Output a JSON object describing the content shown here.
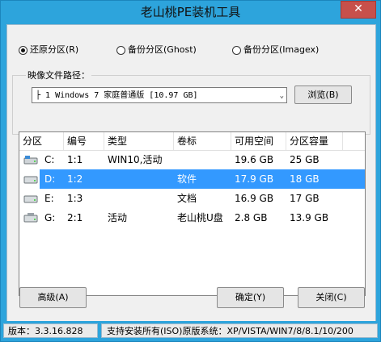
{
  "window": {
    "title": "老山桃PE装机工具",
    "close_symbol": "✕"
  },
  "options": {
    "restore": "还原分区(R)",
    "backup_ghost": "备份分区(Ghost)",
    "backup_imagex": "备份分区(Imagex)",
    "selected": "restore"
  },
  "image_path": {
    "label": "映像文件路径：",
    "value": "├ 1 Windows 7 家庭普通版 [10.97 GB]",
    "browse_label": "浏览(B)"
  },
  "table": {
    "headers": [
      "分区",
      "编号",
      "类型",
      "卷标",
      "可用空间",
      "分区容量"
    ],
    "rows": [
      {
        "drive": "C:",
        "num": "1:1",
        "type": "WIN10,活动",
        "label": "",
        "free": "19.6 GB",
        "size": "25 GB",
        "selected": false
      },
      {
        "drive": "D:",
        "num": "1:2",
        "type": "",
        "label": "软件",
        "free": "17.9 GB",
        "size": "18 GB",
        "selected": true
      },
      {
        "drive": "E:",
        "num": "1:3",
        "type": "",
        "label": "文档",
        "free": "16.9 GB",
        "size": "17 GB",
        "selected": false
      },
      {
        "drive": "G:",
        "num": "2:1",
        "type": "活动",
        "label": "老山桃U盘",
        "free": "2.8 GB",
        "size": "13.9 GB",
        "selected": false
      }
    ]
  },
  "buttons": {
    "advanced": "高级(A)",
    "ok": "确定(Y)",
    "close": "关闭(C)"
  },
  "status": {
    "version": "版本：3.3.16.828",
    "support": "支持安装所有(ISO)原版系统：XP/VISTA/WIN7/8/8.1/10/200"
  }
}
